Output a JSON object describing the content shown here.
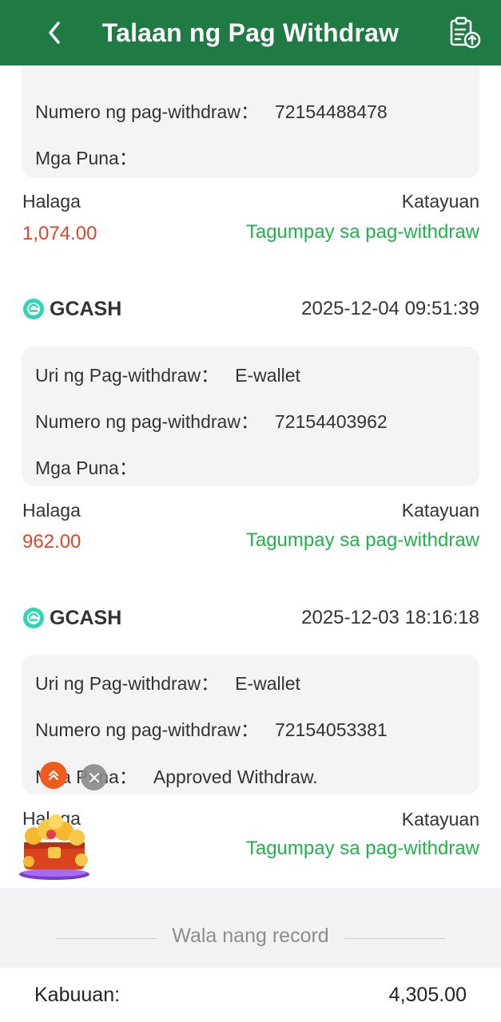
{
  "header": {
    "title": "Talaan ng Pag Withdraw",
    "back_icon": "chevron-left-icon",
    "record_icon": "clipboard-upload-icon"
  },
  "labels": {
    "type": "Uri ng Pag-withdraw：",
    "number": "Numero ng pag-withdraw：",
    "remarks": "Mga Puna：",
    "amount": "Halaga",
    "status": "Katayuan"
  },
  "records": [
    {
      "number": "72154488478",
      "amount": "1,074.00",
      "status": "Tagumpay sa pag-withdraw"
    },
    {
      "provider": "GCASH",
      "datetime": "2025-12-04 09:51:39",
      "type": "E-wallet",
      "number": "72154403962",
      "remarks": "",
      "amount": "962.00",
      "status": "Tagumpay sa pag-withdraw"
    },
    {
      "provider": "GCASH",
      "datetime": "2025-12-03 18:16:18",
      "type": "E-wallet",
      "number": "72154053381",
      "remarks": "Approved Withdraw.",
      "amount": "",
      "status": "Tagumpay sa pag-withdraw"
    }
  ],
  "end_message": "Wala nang record",
  "footer": {
    "total_label": "Kabuuan:",
    "total_value": "4,305.00"
  },
  "colors": {
    "header_bg": "#1f7a43",
    "amount": "#e0452b",
    "status_success": "#22b24c",
    "gcash_logo": "#2fd6b5"
  }
}
